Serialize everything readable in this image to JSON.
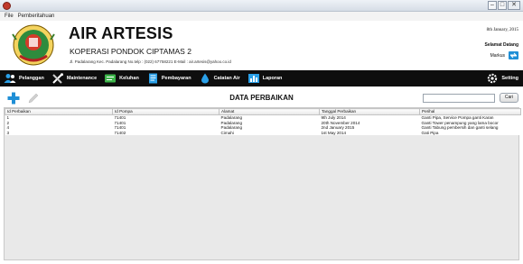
{
  "menubar": {
    "items": [
      "File",
      "Pemberitahuan"
    ]
  },
  "header": {
    "title": "AIR ARTESIS",
    "organization": "KOPERASI PONDOK CIPTAMAS 2",
    "address": "Jl. Padalarang Kec. Padalarang No.telp : (022) 67758221 E-Mail : air.artesis@yahoo.co.id",
    "date": "8th January, 2015",
    "welcome": "Selamat Datang",
    "user": "Markus"
  },
  "nav": {
    "items": [
      {
        "label": "Pelanggan",
        "icon": "users-icon"
      },
      {
        "label": "Maintenance",
        "icon": "tools-icon"
      },
      {
        "label": "Keluhan",
        "icon": "message-icon"
      },
      {
        "label": "Pembayaran",
        "icon": "document-icon"
      },
      {
        "label": "Catatan Air",
        "icon": "water-drop-icon"
      },
      {
        "label": "Laporan",
        "icon": "bar-chart-icon"
      }
    ],
    "setting": "Setting"
  },
  "toolbar": {
    "title": "DATA PERBAIKAN",
    "search_value": "",
    "search_button": "Cari"
  },
  "table": {
    "columns": [
      "Id Perbaikan",
      "Id Pompa",
      "Alamat",
      "Tanggal Perbaikan",
      "Perihal"
    ],
    "rows": [
      [
        "1",
        "71401",
        "Padalarang",
        "9th July 2014",
        "Ganti Pipa, Service Pompa ganti Karan"
      ],
      [
        "2",
        "71401",
        "Padalarang",
        "20th November 2014",
        "Ganti Tower penampung yang lama bocor"
      ],
      [
        "4",
        "71401",
        "Padalarang",
        "2nd January 2015",
        "Ganti Tabung pembersih dan ganti selang"
      ],
      [
        "3",
        "71402",
        "Cimahi",
        "1st May 2014",
        "Gati Pipa"
      ]
    ]
  },
  "colors": {
    "navbar": "#0e0e0e",
    "accent_blue": "#1f8fd6",
    "table_bg": "#e9e9e9"
  }
}
